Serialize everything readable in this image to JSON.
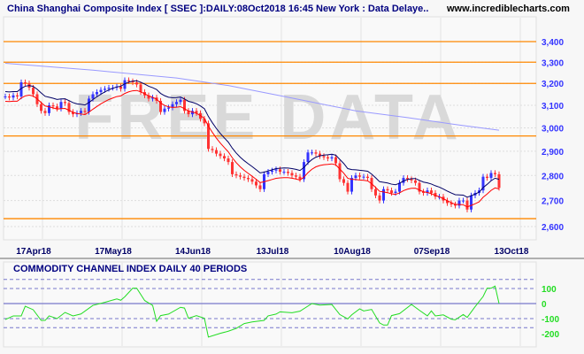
{
  "header": {
    "title": "China Shanghai Composite Index [ SSEC ]:DAILY:08Oct2018 16:45 New York : Data Delaye..",
    "site": "www.incrediblecharts.com"
  },
  "watermark": "FREE DATA",
  "colors": {
    "up": "#3333ff",
    "down": "#ff3333",
    "upper_ma": "#000066",
    "lower_ma": "#ff0000",
    "long_ma": "#9999ff",
    "levels": "#ff8800",
    "cci": "#22dd22"
  },
  "chart_data": [
    {
      "type": "candlestick",
      "title": "China Shanghai Composite Index [ SSEC ] Daily",
      "yscale": "log",
      "ylim": [
        2600,
        3400
      ],
      "yticks": [
        "2,600",
        "2,700",
        "2,800",
        "2,900",
        "3,000",
        "3,100",
        "3,200",
        "3,300",
        "3,400"
      ],
      "ytick_values": [
        2600,
        2700,
        2800,
        2900,
        3000,
        3100,
        3200,
        3300,
        3400
      ],
      "xticks": [
        {
          "label": "17Apr18",
          "i": 9.33
        },
        {
          "label": "17May18",
          "i": 29.33
        },
        {
          "label": "14Jun18",
          "i": 49.33
        },
        {
          "label": "13Jul18",
          "i": 69.33
        },
        {
          "label": "10Aug18",
          "i": 89.33
        },
        {
          "label": "07Sep18",
          "i": 109.33
        },
        {
          "label": "13Oct18",
          "i": 129.33
        }
      ],
      "horizontal_levels": [
        3400,
        3300,
        3200,
        2965,
        2630
      ],
      "close": [
        3140,
        3135,
        3145,
        3140,
        3205,
        3200,
        3180,
        3150,
        3105,
        3075,
        3065,
        3100,
        3095,
        3085,
        3115,
        3110,
        3070,
        3060,
        3065,
        3075,
        3070,
        3130,
        3150,
        3160,
        3170,
        3175,
        3180,
        3180,
        3185,
        3175,
        3215,
        3210,
        3205,
        3195,
        3160,
        3145,
        3130,
        3135,
        3120,
        3070,
        3085,
        3090,
        3105,
        3115,
        3125,
        3075,
        3060,
        3075,
        3065,
        3040,
        3020,
        2910,
        2905,
        2890,
        2880,
        2870,
        2855,
        2805,
        2800,
        2795,
        2790,
        2785,
        2775,
        2760,
        2745,
        2805,
        2815,
        2820,
        2825,
        2815,
        2815,
        2810,
        2800,
        2795,
        2785,
        2855,
        2895,
        2895,
        2890,
        2880,
        2875,
        2870,
        2875,
        2850,
        2785,
        2770,
        2735,
        2790,
        2800,
        2795,
        2795,
        2790,
        2745,
        2720,
        2700,
        2745,
        2740,
        2730,
        2735,
        2770,
        2790,
        2785,
        2780,
        2770,
        2735,
        2730,
        2740,
        2730,
        2715,
        2715,
        2700,
        2690,
        2685,
        2680,
        2700,
        2700,
        2665,
        2720,
        2730,
        2740,
        2795,
        2790,
        2810,
        2805,
        2750
      ],
      "long_ma_points": [
        [
          0,
          3295
        ],
        [
          22,
          3262
        ],
        [
          43,
          3225
        ],
        [
          56,
          3190
        ],
        [
          70,
          3140
        ],
        [
          88,
          3075
        ],
        [
          101,
          3045
        ],
        [
          115,
          3010
        ],
        [
          124,
          2990
        ]
      ]
    },
    {
      "type": "line",
      "title": "COMMODITY CHANNEL INDEX DAILY 40 PERIODS",
      "yticks": [
        "100",
        "0",
        "-100",
        "-200"
      ],
      "ytick_values": [
        100,
        0,
        -100,
        -200
      ],
      "levels": [
        160,
        100,
        -100,
        -160
      ],
      "points": [
        [
          0,
          -106
        ],
        [
          2,
          -82
        ],
        [
          4,
          -82
        ],
        [
          5,
          -18
        ],
        [
          7,
          -41
        ],
        [
          9,
          -112
        ],
        [
          10,
          -112
        ],
        [
          11,
          -82
        ],
        [
          13,
          -100
        ],
        [
          15,
          -59
        ],
        [
          17,
          -82
        ],
        [
          19,
          -69
        ],
        [
          22,
          -12
        ],
        [
          25,
          8
        ],
        [
          28,
          31
        ],
        [
          29,
          22
        ],
        [
          30,
          45
        ],
        [
          32,
          102
        ],
        [
          33,
          102
        ],
        [
          35,
          20
        ],
        [
          37,
          -12
        ],
        [
          38,
          -118
        ],
        [
          39,
          -80
        ],
        [
          41,
          -70
        ],
        [
          44,
          -25
        ],
        [
          45,
          -30
        ],
        [
          46,
          -98
        ],
        [
          48,
          -80
        ],
        [
          50,
          -98
        ],
        [
          51,
          -223
        ],
        [
          54,
          -198
        ],
        [
          56,
          -184
        ],
        [
          58,
          -165
        ],
        [
          60,
          -133
        ],
        [
          62,
          -122
        ],
        [
          65,
          -112
        ],
        [
          66,
          -82
        ],
        [
          68,
          -70
        ],
        [
          69,
          -55
        ],
        [
          72,
          -61
        ],
        [
          74,
          -51
        ],
        [
          77,
          0
        ],
        [
          79,
          -10
        ],
        [
          82,
          -6
        ],
        [
          84,
          -73
        ],
        [
          86,
          -102
        ],
        [
          87,
          -75
        ],
        [
          89,
          -35
        ],
        [
          90,
          -49
        ],
        [
          92,
          -39
        ],
        [
          94,
          -129
        ],
        [
          95,
          -143
        ],
        [
          96,
          -143
        ],
        [
          97,
          -80
        ],
        [
          99,
          -67
        ],
        [
          102,
          -6
        ],
        [
          104,
          -45
        ],
        [
          106,
          -82
        ],
        [
          107,
          -49
        ],
        [
          108,
          -82
        ],
        [
          110,
          -75
        ],
        [
          112,
          -104
        ],
        [
          113,
          -108
        ],
        [
          115,
          -73
        ],
        [
          116,
          -92
        ],
        [
          118,
          -20
        ],
        [
          120,
          47
        ],
        [
          121,
          102
        ],
        [
          122,
          102
        ],
        [
          123,
          116
        ],
        [
          124,
          0
        ]
      ]
    }
  ]
}
